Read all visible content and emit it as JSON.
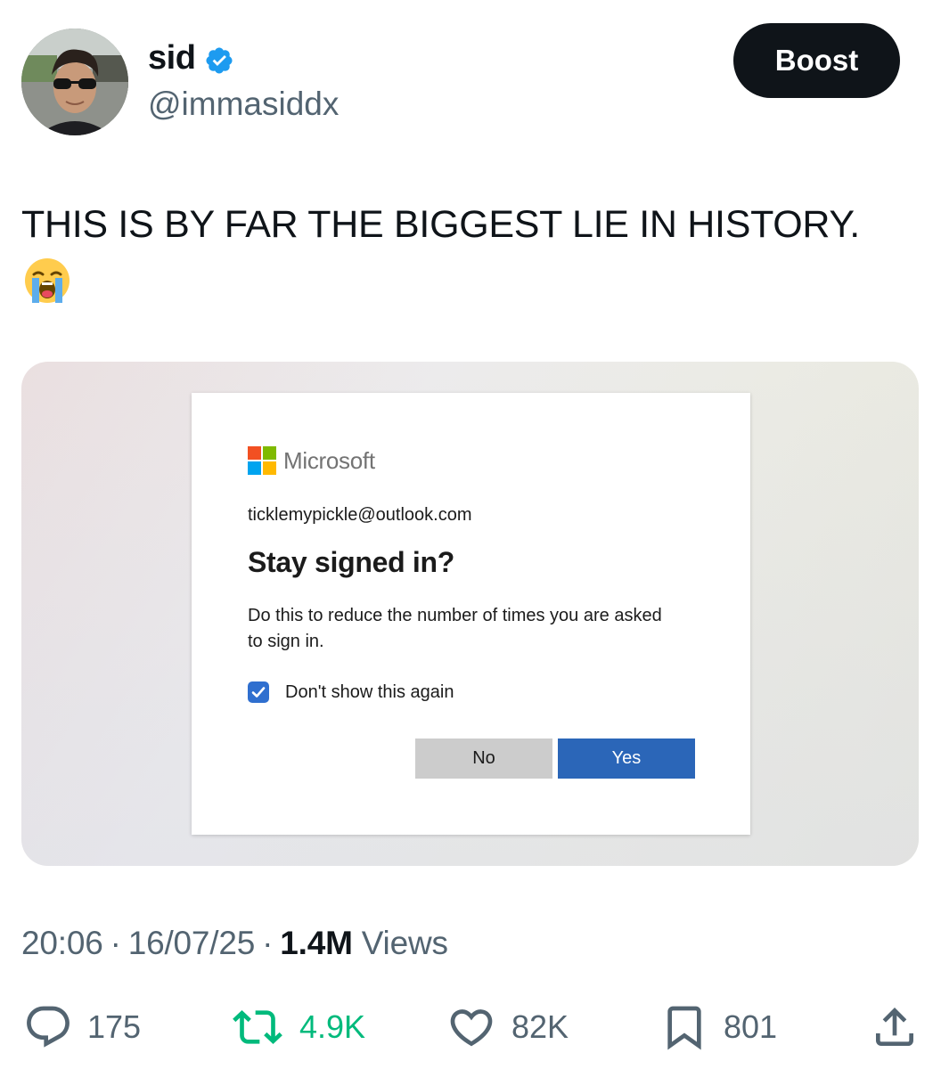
{
  "author": {
    "display_name": "sid",
    "handle": "@immasiddx",
    "verified": true,
    "avatar_icon": "profile-photo"
  },
  "header": {
    "boost_label": "Boost"
  },
  "tweet": {
    "text": "THIS IS BY FAR THE BIGGEST LIE IN HISTORY.",
    "emoji": "loudly-crying-face-icon"
  },
  "media": {
    "dialog": {
      "brand": "Microsoft",
      "email": "ticklemypickle@outlook.com",
      "title": "Stay signed in?",
      "description": "Do this to reduce the number of times you are asked to sign in.",
      "checkbox_label": "Don't show this again",
      "checkbox_checked": true,
      "no_label": "No",
      "yes_label": "Yes",
      "colors": {
        "ms_red": "#f25022",
        "ms_green": "#7fba00",
        "ms_blue": "#00a4ef",
        "ms_yellow": "#ffb900",
        "yes_button": "#2b66b8",
        "no_button": "#cccccc"
      }
    }
  },
  "meta": {
    "time": "20:06",
    "date": "16/07/25",
    "views_count": "1.4M",
    "views_label": "Views"
  },
  "actions": {
    "replies": "175",
    "reposts": "4.9K",
    "likes": "82K",
    "bookmarks": "801"
  },
  "colors": {
    "verified": "#1d9bf0",
    "repost": "#00ba7c",
    "secondary_text": "#536471"
  }
}
